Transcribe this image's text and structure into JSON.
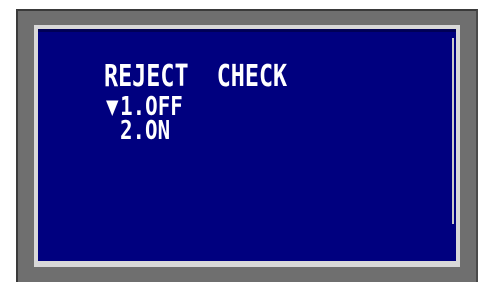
{
  "menu": {
    "title": "REJECT  CHECK",
    "cursor_glyph": "▼",
    "options": [
      {
        "number": "1",
        "label": "OFF",
        "selected": true
      },
      {
        "number": "2",
        "label": "ON",
        "selected": false
      }
    ],
    "option1_text": "1.OFF",
    "option2_text": "2.ON"
  },
  "colors": {
    "screen_background": "#00007f",
    "text": "#ffffff",
    "bezel": "#6f6f6f",
    "inner_frame": "#d8d8d8"
  }
}
